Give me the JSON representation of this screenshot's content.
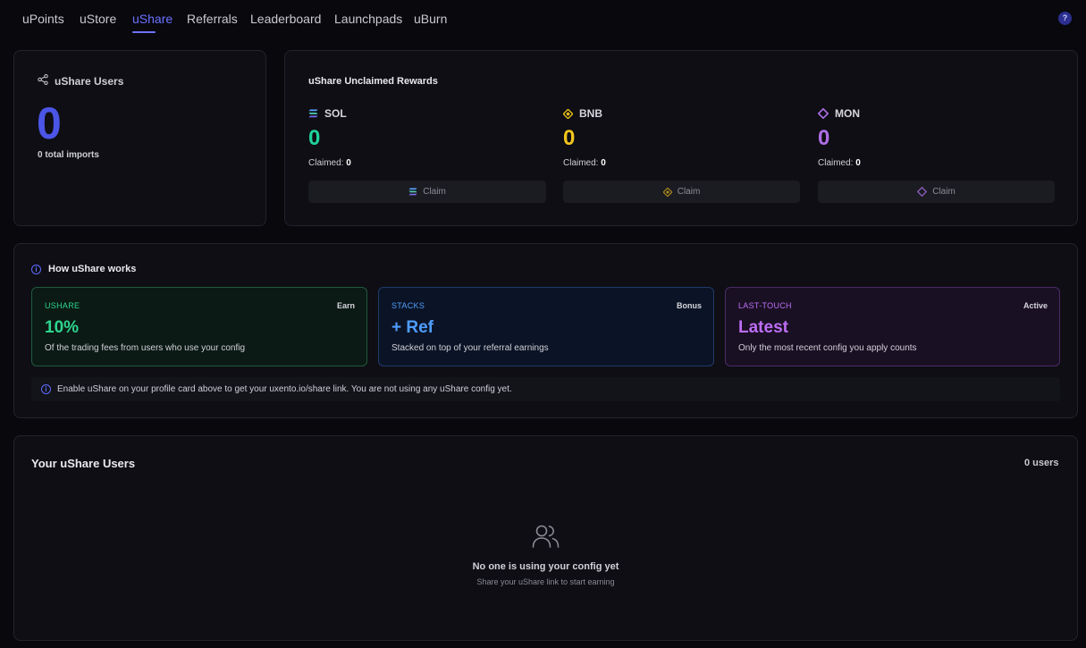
{
  "nav": {
    "tabs": [
      "uPoints",
      "uStore",
      "uShare",
      "Referrals",
      "Leaderboard",
      "Launchpads",
      "uBurn"
    ],
    "active_tab": "uShare",
    "help_label": "?"
  },
  "users_card": {
    "title": "uShare Users",
    "count": "0",
    "imports_text": "0 total imports"
  },
  "rewards": {
    "title": "uShare Unclaimed Rewards",
    "claimed_label": "Claimed:",
    "tokens": [
      {
        "symbol": "SOL",
        "value": "0",
        "claimed": "0",
        "claim_label": "Claim",
        "color": "#1fd39a",
        "icon": "solana-icon"
      },
      {
        "symbol": "BNB",
        "value": "0",
        "claimed": "0",
        "claim_label": "Claim",
        "color": "#f3c51c",
        "icon": "bnb-icon"
      },
      {
        "symbol": "MON",
        "value": "0",
        "claimed": "0",
        "claim_label": "Claim",
        "color": "#b06ee6",
        "icon": "monad-icon"
      }
    ]
  },
  "how": {
    "title": "How uShare works",
    "features": [
      {
        "label": "USHARE",
        "tag": "Earn",
        "value": "10%",
        "desc": "Of the trading fees from users who use your config",
        "color": "#2ed58f"
      },
      {
        "label": "STACKS",
        "tag": "Bonus",
        "value": "+ Ref",
        "desc": "Stacked on top of your referral earnings",
        "color": "#4f9dff"
      },
      {
        "label": "LAST-TOUCH",
        "tag": "Active",
        "value": "Latest",
        "desc": "Only the most recent config you apply counts",
        "color": "#bd6ef5"
      }
    ],
    "notice": "Enable uShare on your profile card above to get your uxento.io/share link. You are not using any uShare config yet."
  },
  "your_users": {
    "title": "Your uShare Users",
    "count_label": "0 users",
    "empty_title": "No one is using your config yet",
    "empty_subtitle": "Share your uShare link to start earning"
  }
}
